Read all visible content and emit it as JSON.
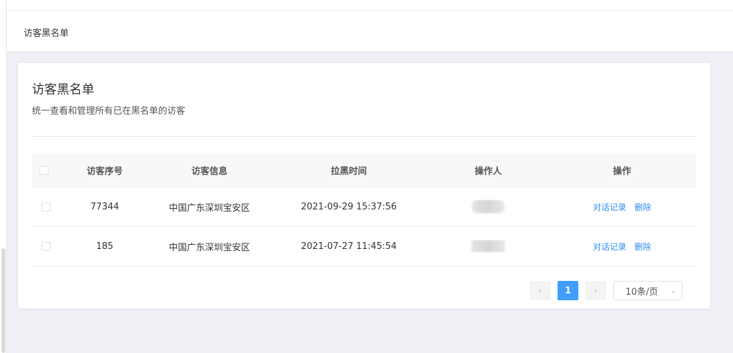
{
  "breadcrumb": "访客黑名单",
  "card": {
    "title": "访客黑名单",
    "subtitle": "统一查看和管理所有已在黑名单的访客"
  },
  "table": {
    "headers": {
      "id": "访客序号",
      "info": "访客信息",
      "time": "拉黑时间",
      "operator": "操作人",
      "actions": "操作"
    },
    "rows": [
      {
        "id": "77344",
        "info": "中国广东深圳宝安区",
        "time": "2021-09-29 15:37:56",
        "view": "对话记录",
        "delete": "删除"
      },
      {
        "id": "185",
        "info": "中国广东深圳宝安区",
        "time": "2021-07-27 11:45:54",
        "view": "对话记录",
        "delete": "删除"
      }
    ]
  },
  "pagination": {
    "prev_icon": "chevron-left-icon",
    "current": "1",
    "next_icon": "chevron-right-icon",
    "page_size": "10条/页",
    "dropdown_icon": "chevron-down-icon"
  },
  "colors": {
    "accent": "#409eff",
    "link": "#2d8cf0",
    "background": "#eef0f5"
  }
}
